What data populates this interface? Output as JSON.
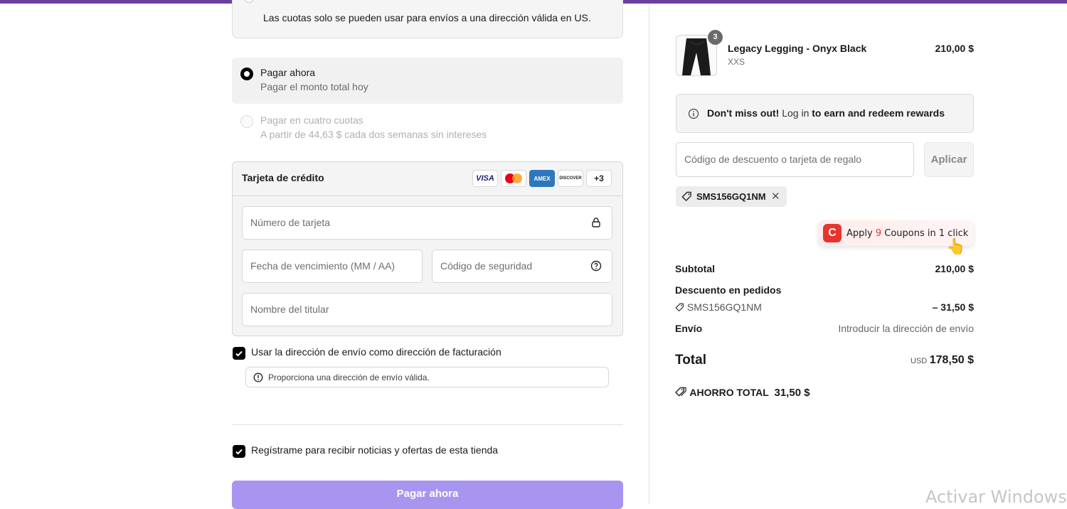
{
  "notice": {
    "text": "Las cuotas solo se pueden usar para envíos a una dirección válida en US."
  },
  "payment_options": [
    {
      "title": "Pagar ahora",
      "subtitle": "Pagar el monto total hoy",
      "selected": true
    },
    {
      "title": "Pagar en cuatro cuotas",
      "subtitle": "A partir de 44,63 $ cada dos semanas sin intereses",
      "selected": false
    }
  ],
  "card": {
    "title": "Tarjeta de crédito",
    "logos": [
      "VISA",
      "mastercard-icon",
      "AMEX",
      "DISCOVER",
      "+3"
    ],
    "number_placeholder": "Número de tarjeta",
    "expiry_placeholder": "Fecha de vencimiento (MM / AA)",
    "cvc_placeholder": "Código de seguridad",
    "name_placeholder": "Nombre del titular"
  },
  "billing": {
    "checkbox_label": "Usar la dirección de envío como dirección de facturación",
    "warning": "Proporciona una dirección de envío válida."
  },
  "newsletter": {
    "checkbox_label": "Regístrame para recibir noticias y ofertas de esta tienda"
  },
  "pay_button": "Pagar ahora",
  "cart": {
    "item": {
      "name": "Legacy Legging - Onyx Black",
      "variant": "XXS",
      "price": "210,00 $",
      "quantity": "3"
    }
  },
  "rewards": {
    "prefix": "Don't miss out!",
    "link": "Log in",
    "suffix": "to earn and redeem rewards"
  },
  "discount": {
    "placeholder": "Código de descuento o tarjeta de regalo",
    "apply_label": "Aplicar",
    "applied_code": "SMS156GQ1NM"
  },
  "coupon_ext": {
    "prefix": "Apply",
    "count": "9",
    "suffix": "Coupons in 1 click"
  },
  "summary": {
    "subtotal_label": "Subtotal",
    "subtotal_value": "210,00 $",
    "discount_label": "Descuento en pedidos",
    "discount_code": "SMS156GQ1NM",
    "discount_value": "– 31,50 $",
    "shipping_label": "Envío",
    "shipping_value": "Introducir la dirección de envío",
    "total_label": "Total",
    "total_currency": "USD",
    "total_value": "178,50 $",
    "savings_label": "AHORRO TOTAL",
    "savings_value": "31,50 $"
  },
  "watermark": "Activar Windows",
  "colors": {
    "accent_bar": "#6b3fa0",
    "pay_button": "#a795f0",
    "coupon_brand": "#e8342e"
  }
}
